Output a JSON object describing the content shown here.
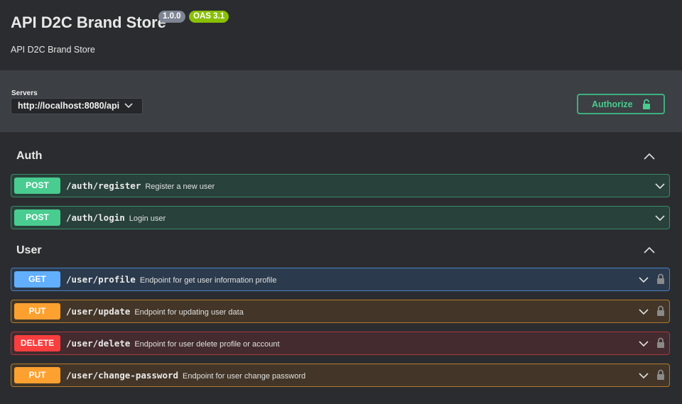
{
  "info": {
    "title": "API D2C Brand Store",
    "version": "1.0.0",
    "oas": "OAS 3.1",
    "description": "API D2C Brand Store"
  },
  "servers": {
    "label": "Servers",
    "selected": "http://localhost:8080/api"
  },
  "authorize": {
    "label": "Authorize"
  },
  "colors": {
    "post": "#49cc90",
    "get": "#61affe",
    "put": "#fca130",
    "delete": "#f93e3e"
  },
  "sections": [
    {
      "name": "Auth",
      "operations": [
        {
          "method": "POST",
          "path": "/auth/register",
          "summary": "Register a new user"
        },
        {
          "method": "POST",
          "path": "/auth/login",
          "summary": "Login user"
        }
      ]
    },
    {
      "name": "User",
      "operations": [
        {
          "method": "GET",
          "path": "/user/profile",
          "summary": "Endpoint for get user information profile"
        },
        {
          "method": "PUT",
          "path": "/user/update",
          "summary": "Endpoint for updating user data"
        },
        {
          "method": "DELETE",
          "path": "/user/delete",
          "summary": "Endpoint for user delete profile or account"
        },
        {
          "method": "PUT",
          "path": "/user/change-password",
          "summary": "Endpoint for user change password"
        }
      ]
    }
  ]
}
